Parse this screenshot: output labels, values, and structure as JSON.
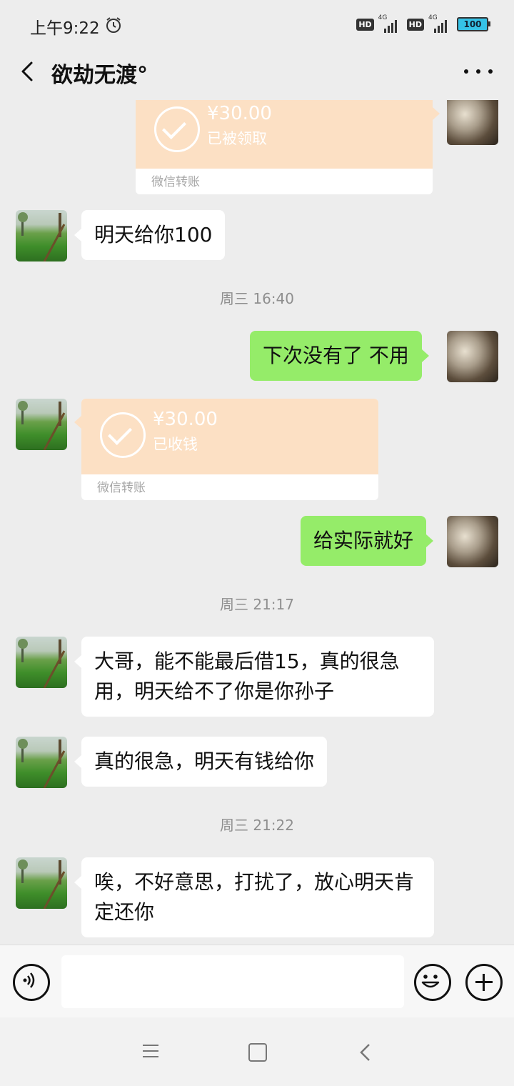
{
  "status_bar": {
    "time": "上午9:22",
    "hd1": "HD",
    "net1": "4G",
    "hd2": "HD",
    "net2": "4G",
    "battery": "100",
    "icons": [
      "alarm-icon",
      "signal-icon",
      "battery-icon"
    ]
  },
  "header": {
    "title": "欲劫无渡°",
    "icons": [
      "back-arrow-icon",
      "more-dots-icon"
    ]
  },
  "messages": {
    "m1": {
      "amount": "¥30.00",
      "status": "已被领取",
      "label": "微信转账"
    },
    "m2": {
      "text": "明天给你100"
    },
    "t1": "周三 16:40",
    "m3": {
      "text": "下次没有了 不用"
    },
    "m4": {
      "amount": "¥30.00",
      "status": "已收钱",
      "label": "微信转账"
    },
    "m5": {
      "text": "给实际就好"
    },
    "t2": "周三 21:17",
    "m6": {
      "text": "大哥，能不能最后借15，真的很急用，明天给不了你是你孙子"
    },
    "m7": {
      "text": "真的很急，明天有钱给你"
    },
    "t3": "周三 21:22",
    "m8": {
      "text": "唉，不好意思，打扰了，放心明天肯定还你"
    }
  },
  "input_bar": {
    "icons": [
      "voice-icon",
      "emoji-icon",
      "plus-icon"
    ],
    "text_value": ""
  },
  "nav_bar": {
    "icons": [
      "menu-icon",
      "home-icon",
      "back-icon"
    ]
  },
  "colors": {
    "background": "#ededed",
    "self_bubble": "#95ec69",
    "other_bubble": "#ffffff",
    "transfer_card": "#fce0c4"
  }
}
